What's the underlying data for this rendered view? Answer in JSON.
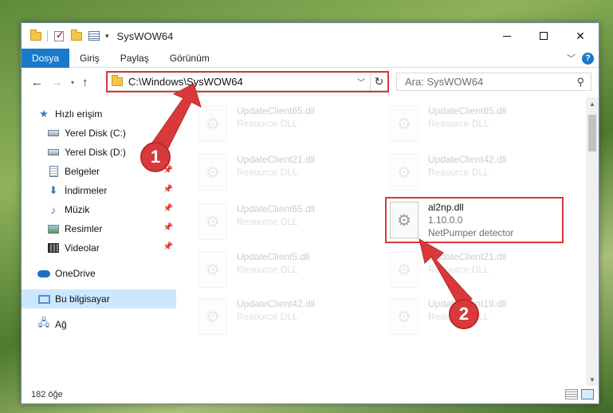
{
  "window": {
    "title": "SysWOW64"
  },
  "ribbon": {
    "tabs": [
      "Dosya",
      "Giriş",
      "Paylaş",
      "Görünüm"
    ]
  },
  "address": {
    "path": "C:\\Windows\\SysWOW64"
  },
  "search": {
    "placeholder": "Ara: SysWOW64"
  },
  "sidebar": {
    "items": [
      {
        "label": "Hızlı erişim",
        "icon": "star-icon"
      },
      {
        "label": "Yerel Disk (C:)",
        "icon": "drive-icon"
      },
      {
        "label": "Yerel Disk (D:)",
        "icon": "drive-icon"
      },
      {
        "label": "Belgeler",
        "icon": "documents-icon"
      },
      {
        "label": "İndirmeler",
        "icon": "download-icon"
      },
      {
        "label": "Müzik",
        "icon": "music-icon"
      },
      {
        "label": "Resimler",
        "icon": "pictures-icon"
      },
      {
        "label": "Videolar",
        "icon": "videos-icon"
      },
      {
        "label": "OneDrive",
        "icon": "cloud-icon"
      },
      {
        "label": "Bu bilgisayar",
        "icon": "computer-icon"
      },
      {
        "label": "Ağ",
        "icon": "network-icon"
      }
    ]
  },
  "files": [
    {
      "name": "UpdateClient65.dll",
      "type": "Resource DLL"
    },
    {
      "name": "UpdateClient65.dll",
      "type": "Resource DLL"
    },
    {
      "name": "UpdateClient21.dll",
      "type": "Resource DLL"
    },
    {
      "name": "UpdateClient42.dll",
      "type": "Resource DLL"
    },
    {
      "name": "UpdateClient65.dll",
      "type": "Resource DLL"
    },
    {
      "name": "al2np.dll",
      "version": "1.10.0.0",
      "description": "NetPumper detector"
    },
    {
      "name": "UpdateClient5.dll",
      "type": "Resource DLL"
    },
    {
      "name": "UpdateClient21.dll",
      "type": "Resource DLL"
    },
    {
      "name": "UpdateClient42.dll",
      "type": "Resource DLL"
    },
    {
      "name": "UpdateClient19.dll",
      "type": "Resource DLL"
    }
  ],
  "status": {
    "count": "182 öğe"
  },
  "annotations": {
    "step1": "1",
    "step2": "2"
  },
  "colors": {
    "accent": "#1979ca",
    "highlight": "#d9393a",
    "selected": "#cce8ff"
  }
}
